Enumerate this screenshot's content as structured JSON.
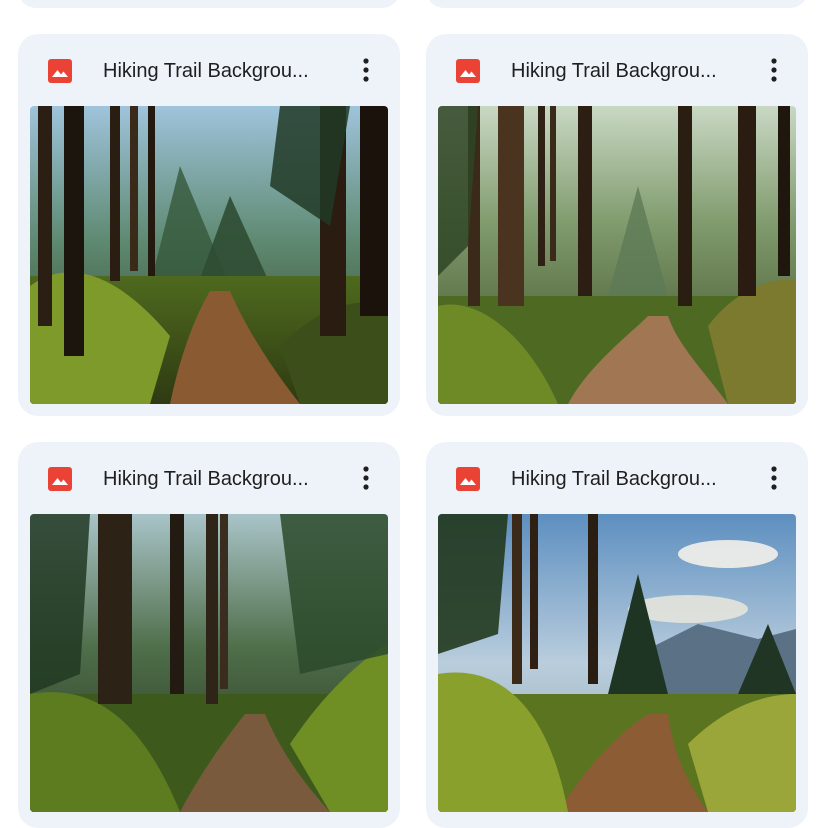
{
  "files": [
    {
      "name": "Hiking Trail Backgrou..."
    },
    {
      "name": "Hiking Trail Backgrou..."
    },
    {
      "name": "Hiking Trail Backgrou..."
    },
    {
      "name": "Hiking Trail Backgrou..."
    }
  ],
  "icons": {
    "file_type": "image-file-icon",
    "more": "more-vert-icon"
  },
  "colors": {
    "card_bg": "#eef2f9",
    "image_icon_red": "#ea4335",
    "text": "#1f1f1f"
  }
}
